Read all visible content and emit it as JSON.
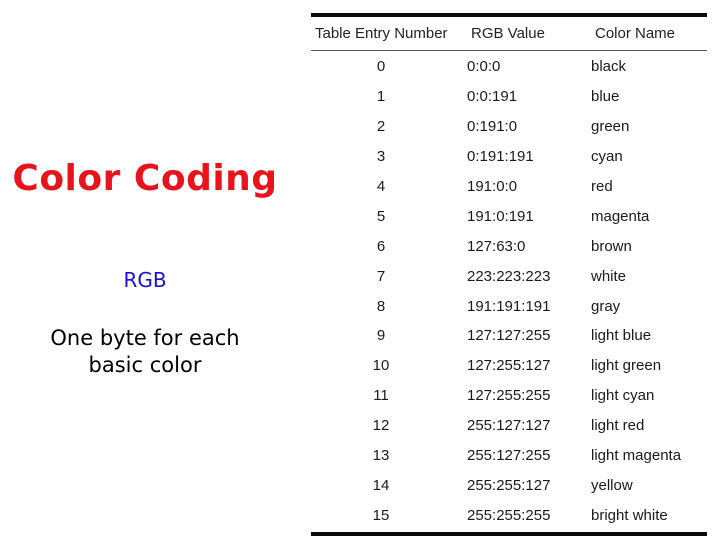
{
  "slide": {
    "title": "Color Coding",
    "subtitle": "RGB",
    "description_line1": "One byte for each",
    "description_line2": "basic color"
  },
  "table": {
    "headers": [
      "Table Entry Number",
      "RGB Value",
      "Color Name"
    ],
    "rows": [
      {
        "entry": "0",
        "rgb": "0:0:0",
        "name": "black"
      },
      {
        "entry": "1",
        "rgb": "0:0:191",
        "name": "blue"
      },
      {
        "entry": "2",
        "rgb": "0:191:0",
        "name": "green"
      },
      {
        "entry": "3",
        "rgb": "0:191:191",
        "name": "cyan"
      },
      {
        "entry": "4",
        "rgb": "191:0:0",
        "name": "red"
      },
      {
        "entry": "5",
        "rgb": "191:0:191",
        "name": "magenta"
      },
      {
        "entry": "6",
        "rgb": "127:63:0",
        "name": "brown"
      },
      {
        "entry": "7",
        "rgb": "223:223:223",
        "name": "white"
      },
      {
        "entry": "8",
        "rgb": "191:191:191",
        "name": "gray"
      },
      {
        "entry": "9",
        "rgb": "127:127:255",
        "name": "light blue"
      },
      {
        "entry": "10",
        "rgb": "127:255:127",
        "name": "light green"
      },
      {
        "entry": "11",
        "rgb": "127:255:255",
        "name": "light cyan"
      },
      {
        "entry": "12",
        "rgb": "255:127:127",
        "name": "light red"
      },
      {
        "entry": "13",
        "rgb": "255:127:255",
        "name": "light magenta"
      },
      {
        "entry": "14",
        "rgb": "255:255:127",
        "name": "yellow"
      },
      {
        "entry": "15",
        "rgb": "255:255:255",
        "name": "bright white"
      }
    ]
  },
  "colors": {
    "title": "#e8141c",
    "subtitle": "#1a12c8"
  }
}
